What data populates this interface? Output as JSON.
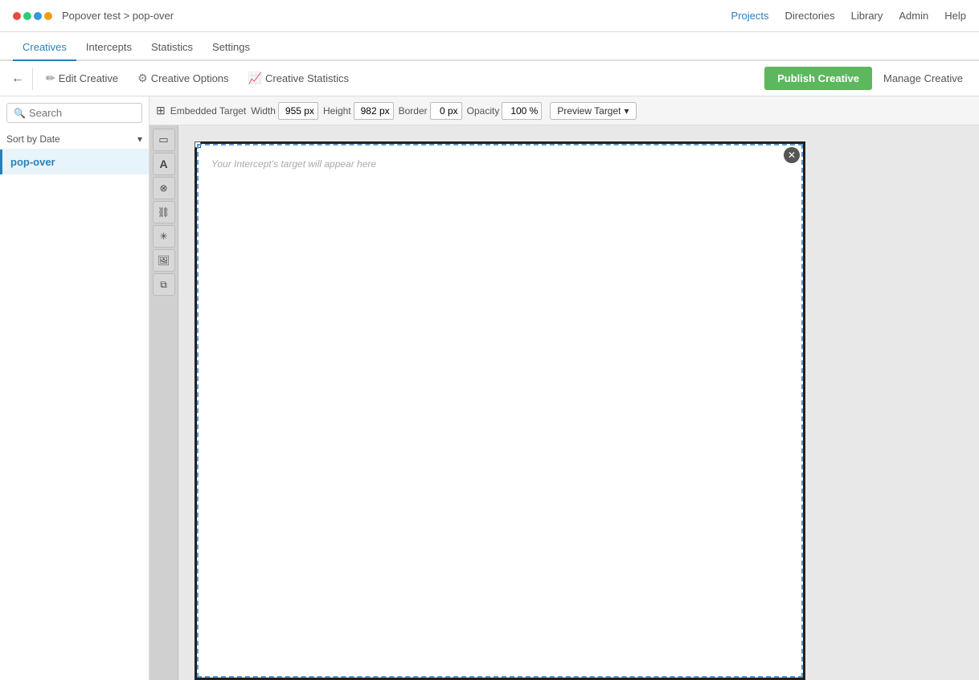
{
  "app": {
    "title": "Popover test > pop-over",
    "logo_dots": [
      "red",
      "green",
      "blue",
      "orange"
    ]
  },
  "top_nav": {
    "links": [
      {
        "label": "Projects",
        "active": true
      },
      {
        "label": "Directories",
        "active": false
      },
      {
        "label": "Library",
        "active": false
      },
      {
        "label": "Admin",
        "active": false
      },
      {
        "label": "Help",
        "active": false
      }
    ]
  },
  "sec_nav": {
    "tabs": [
      {
        "label": "Creatives",
        "active": true
      },
      {
        "label": "Intercepts",
        "active": false
      },
      {
        "label": "Statistics",
        "active": false
      },
      {
        "label": "Settings",
        "active": false
      }
    ]
  },
  "toolbar": {
    "back_icon": "←",
    "edit_creative_label": "Edit Creative",
    "creative_options_label": "Creative Options",
    "creative_statistics_label": "Creative Statistics",
    "publish_label": "Publish Creative",
    "manage_label": "Manage Creative"
  },
  "sidebar": {
    "search_placeholder": "Search",
    "sort_label": "Sort by Date",
    "items": [
      {
        "label": "pop-over",
        "active": true
      }
    ]
  },
  "canvas_toolbar": {
    "embedded_target_label": "Embedded Target",
    "width_label": "Width",
    "width_value": "955 px",
    "height_label": "Height",
    "height_value": "982 px",
    "border_label": "Border",
    "border_value": "0 px",
    "opacity_label": "Opacity",
    "opacity_value": "100 %",
    "preview_target_label": "Preview Target"
  },
  "canvas": {
    "target_text": "Your Intercept's target will appear here"
  },
  "tools": [
    {
      "icon": "▭",
      "name": "rectangle-tool"
    },
    {
      "icon": "A",
      "name": "text-tool"
    },
    {
      "icon": "✕",
      "name": "close-tool"
    },
    {
      "icon": "🔗",
      "name": "link-tool"
    },
    {
      "icon": "⚙",
      "name": "settings-tool"
    },
    {
      "icon": "🖼",
      "name": "image-tool"
    },
    {
      "icon": "⧉",
      "name": "duplicate-tool"
    }
  ]
}
